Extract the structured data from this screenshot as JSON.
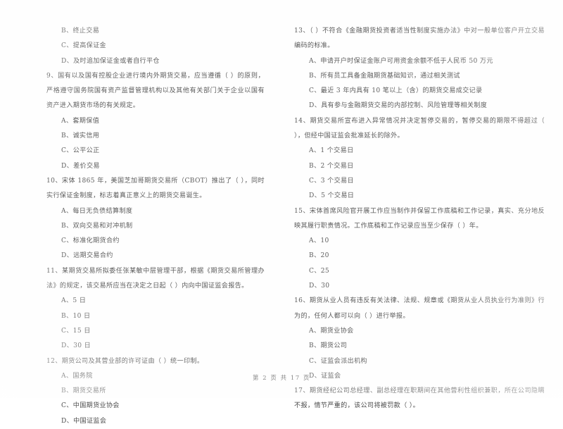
{
  "document": {
    "type": "exam-paper",
    "language": "zh-CN",
    "footer": "第 2 页 共 17 页"
  },
  "left_column": {
    "orphan_options": [
      "B、终止交易",
      "C、提高保证金",
      "D、及时追加保证金或者自行平仓"
    ],
    "questions": [
      {
        "number": "9",
        "text": "9、国有以及国有控股企业进行境内外期货交易，应当遵循（      ）的原则，严格遵守国务院国有资产监督管理机构以及其他有关部门关于企业以国有资产进入期货市场的有关规定。",
        "options": [
          "A、套期保值",
          "B、诚实信用",
          "C、公平公正",
          "D、差价交易"
        ]
      },
      {
        "number": "10",
        "text": "10、宋体 1865 年，美国芝加哥期货交易所（CBOT）推出了（      ），同时实行保证金制度，标志着真正意义上的期货交易诞生。",
        "options": [
          "A、每日无负债结算制度",
          "B、双向交易和对冲机制",
          "C、标准化期货合约",
          "D、远期交易合约"
        ]
      },
      {
        "number": "11",
        "text": "11、某期货交易所拟委任张某敏中层管理干部，根据《期货交易所管理办法》的规定，该交易所应当在决定之日起（      ）内向中国证监会报告。",
        "options": [
          "A、5 日",
          "B、10 日",
          "C、15 日",
          "D、30 日"
        ]
      },
      {
        "number": "12",
        "text": "12、期货公司及其营业部的许可证由（      ）统一印制。",
        "options": [
          "A、国务院",
          "B、期货交易所",
          "C、中国期货业协会",
          "D、中国证监会"
        ]
      }
    ]
  },
  "right_column": {
    "questions": [
      {
        "number": "13",
        "text": "13、（      ）不符合《金融期货投资者适当性制度实施办法》中对一般单位客户开立交易编码的标准。",
        "options": [
          "A、申请开户时保证金账户可用资金余额不低于人民币 50 万元",
          "B、所有员工具备金融期货基础知识，通过相关测试",
          "C、最近 3 年内具有 10 笔以上（含）的期货交易成交记录",
          "D、具有参与金融期货交易的内部控制、风险管理等相关制度"
        ]
      },
      {
        "number": "14",
        "text": "14、期货交易所宣布进入异常情况并决定暂停交易的，暂停交易的期限不得超过（      ），但经中国证监会批准延长的除外。",
        "options": [
          "A、1 个交易日",
          "B、2 个交易日",
          "C、3 个交易日",
          "D、5 个交易日"
        ]
      },
      {
        "number": "15",
        "text": "15、宋体首席风险官开展工作应当制作并保留工作底稿和工作记录，真实、充分地反映其履行职责情况。工作底稿和工作记录应当至少保存（      ）年。",
        "options": [
          "A、10",
          "B、20",
          "C、25",
          "D、30"
        ]
      },
      {
        "number": "16",
        "text": "16、期货从业人员有违反有关法律、法规、规章或《期货从业人员执业行为准则》行为的，任何人都可以向（      ）进行举报。",
        "options": [
          "A、期货业协会",
          "B、期货公司",
          "C、证监会派出机构",
          "D、证监会"
        ]
      },
      {
        "number": "17",
        "text": "17、期货经纪公司总经理、副总经理在职期间在其他营利性组织兼职，所在公司隐瞒不报，情节严重的，该公司将被罚款（      ）。",
        "options": []
      }
    ]
  }
}
